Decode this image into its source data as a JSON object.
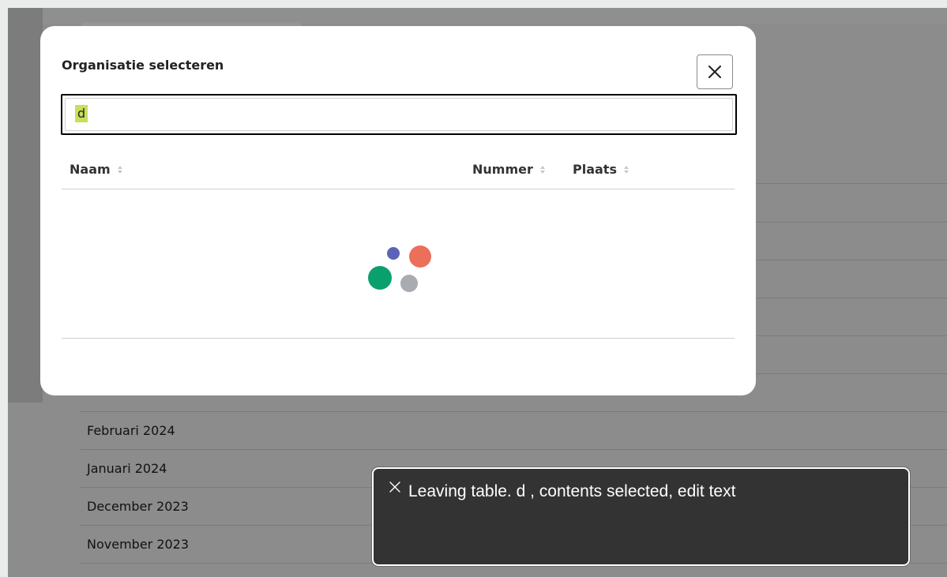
{
  "background": {
    "months": [
      "Februari 2024",
      "Januari 2024",
      "December 2023",
      "November 2023"
    ]
  },
  "modal": {
    "title": "Organisatie selecteren",
    "search": {
      "value": "d",
      "placeholder": ""
    },
    "close_icon": "close-icon",
    "columns": [
      {
        "label": "Naam",
        "sortable": true
      },
      {
        "label": "Nummer",
        "sortable": true
      },
      {
        "label": "Plaats",
        "sortable": true
      }
    ],
    "loading": true,
    "loader_colors": [
      "#5b63b7",
      "#ec6f5a",
      "#0aa06e",
      "#a8abb0"
    ]
  },
  "toast": {
    "text": "Leaving table. d , contents selected, edit text",
    "close_icon": "close-icon"
  }
}
